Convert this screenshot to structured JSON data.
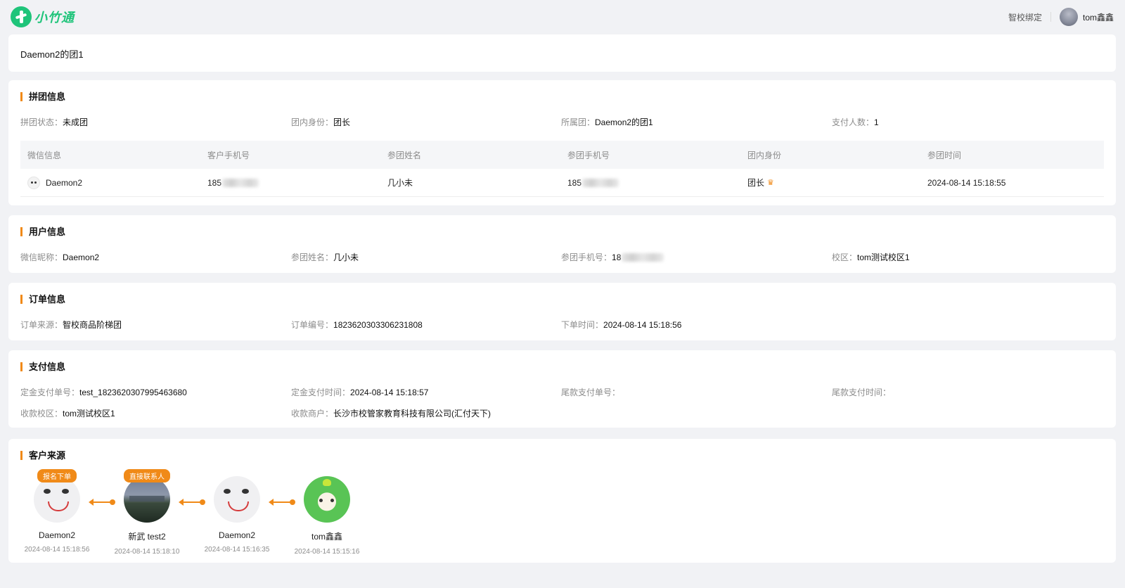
{
  "header": {
    "logo_text": "小竹通",
    "bind_school": "智校绑定",
    "user_name": "tom鑫鑫"
  },
  "page_title": "Daemon2的团1",
  "group_info": {
    "title": "拼团信息",
    "status": {
      "label": "拼团状态：",
      "value": "未成团"
    },
    "role": {
      "label": "团内身份：",
      "value": "团长"
    },
    "group": {
      "label": "所属团：",
      "value": "Daemon2的团1"
    },
    "paid_count": {
      "label": "支付人数：",
      "value": "1"
    },
    "table": {
      "headers": [
        "微信信息",
        "客户手机号",
        "参团姓名",
        "参团手机号",
        "团内身份",
        "参团时间"
      ],
      "rows": [
        {
          "wechat": "Daemon2",
          "customer_phone": "185",
          "name": "几小未",
          "member_phone": "185",
          "role": "团长",
          "time": "2024-08-14 15:18:55"
        }
      ]
    }
  },
  "user_info": {
    "title": "用户信息",
    "nickname": {
      "label": "微信昵称：",
      "value": "Daemon2"
    },
    "name": {
      "label": "参团姓名：",
      "value": "几小未"
    },
    "phone": {
      "label": "参团手机号：",
      "value": "18"
    },
    "campus": {
      "label": "校区：",
      "value": "tom测试校区1"
    }
  },
  "order_info": {
    "title": "订单信息",
    "source": {
      "label": "订单来源：",
      "value": "智校商品阶梯团"
    },
    "number": {
      "label": "订单编号：",
      "value": "1823620303306231808"
    },
    "time": {
      "label": "下单时间：",
      "value": "2024-08-14 15:18:56"
    }
  },
  "pay_info": {
    "title": "支付信息",
    "deposit_no": {
      "label": "定金支付单号：",
      "value": "test_1823620307995463680"
    },
    "deposit_time": {
      "label": "定金支付时间：",
      "value": "2024-08-14 15:18:57"
    },
    "final_no": {
      "label": "尾款支付单号：",
      "value": ""
    },
    "final_time": {
      "label": "尾款支付时间：",
      "value": ""
    },
    "campus": {
      "label": "收款校区：",
      "value": "tom测试校区1"
    },
    "merchant": {
      "label": "收款商户：",
      "value": "长沙市校管家教育科技有限公司(汇付天下)"
    }
  },
  "source_info": {
    "title": "客户来源",
    "nodes": [
      {
        "name": "Daemon2",
        "time": "2024-08-14 15:18:56",
        "badge": "报名下单",
        "avatar": "seal"
      },
      {
        "name": "新武 test2",
        "time": "2024-08-14 15:18:10",
        "badge": "直接联系人",
        "avatar": "photo"
      },
      {
        "name": "Daemon2",
        "time": "2024-08-14 15:16:35",
        "badge": "",
        "avatar": "seal"
      },
      {
        "name": "tom鑫鑫",
        "time": "2024-08-14 15:15:16",
        "badge": "",
        "avatar": "mascot"
      }
    ]
  },
  "colors": {
    "accent": "#f08a18",
    "brand": "#1fc47a"
  }
}
